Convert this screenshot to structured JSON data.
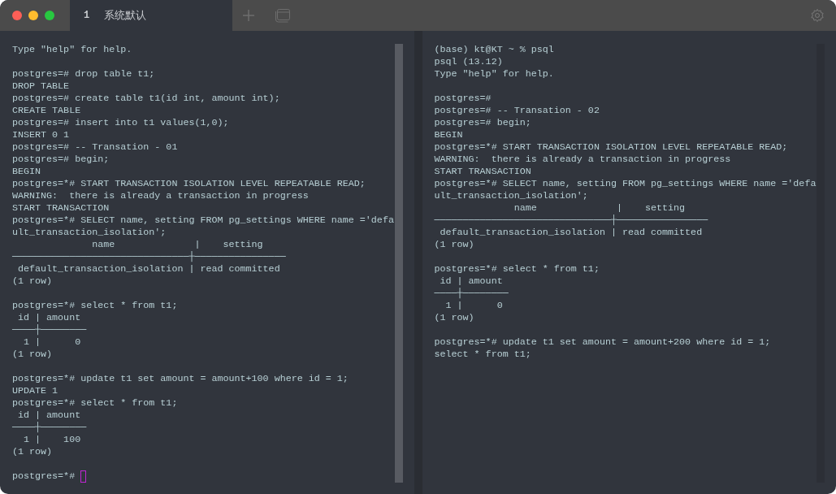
{
  "window": {
    "tabs": [
      {
        "number": "1",
        "label": "系统默认",
        "selected": true
      }
    ]
  },
  "panes": [
    {
      "scroll_thumb": true,
      "cursor": true,
      "blocks": [
        [
          "Type \"help\" for help."
        ],
        [
          "postgres=# drop table t1;",
          "DROP TABLE",
          "postgres=# create table t1(id int, amount int);",
          "CREATE TABLE",
          "postgres=# insert into t1 values(1,0);",
          "INSERT 0 1",
          "postgres=# -- Transation - 01",
          "postgres=# begin;",
          "BEGIN",
          "postgres=*# START TRANSACTION ISOLATION LEVEL REPEATABLE READ;",
          "WARNING:  there is already a transaction in progress",
          "START TRANSACTION",
          "postgres=*# SELECT name, setting FROM pg_settings WHERE name ='defa",
          "ult_transaction_isolation';",
          "              name              |    setting",
          "───────────────────────────────┼────────────────",
          " default_transaction_isolation | read committed",
          "(1 row)"
        ],
        [
          "postgres=*# select * from t1;",
          " id | amount",
          "────┼────────",
          "  1 |      0",
          "(1 row)"
        ],
        [
          "postgres=*# update t1 set amount = amount+100 where id = 1;",
          "UPDATE 1",
          "postgres=*# select * from t1;",
          " id | amount",
          "────┼────────",
          "  1 |    100",
          "(1 row)"
        ],
        [
          "postgres=*#"
        ]
      ]
    },
    {
      "scroll_thumb": false,
      "cursor": false,
      "blocks": [
        [
          "(base) kt@KT ~ % psql",
          "psql (13.12)",
          "Type \"help\" for help."
        ],
        [
          "postgres=#",
          "postgres=# -- Transation - 02",
          "postgres=# begin;",
          "BEGIN",
          "postgres=*# START TRANSACTION ISOLATION LEVEL REPEATABLE READ;",
          "WARNING:  there is already a transaction in progress",
          "START TRANSACTION",
          "postgres=*# SELECT name, setting FROM pg_settings WHERE name ='defa",
          "ult_transaction_isolation';",
          "              name              |    setting",
          "───────────────────────────────┼────────────────",
          " default_transaction_isolation | read committed",
          "(1 row)"
        ],
        [
          "postgres=*# select * from t1;",
          " id | amount",
          "────┼────────",
          "  1 |      0",
          "(1 row)"
        ],
        [
          "postgres=*# update t1 set amount = amount+200 where id = 1;",
          "select * from t1;"
        ]
      ]
    }
  ]
}
